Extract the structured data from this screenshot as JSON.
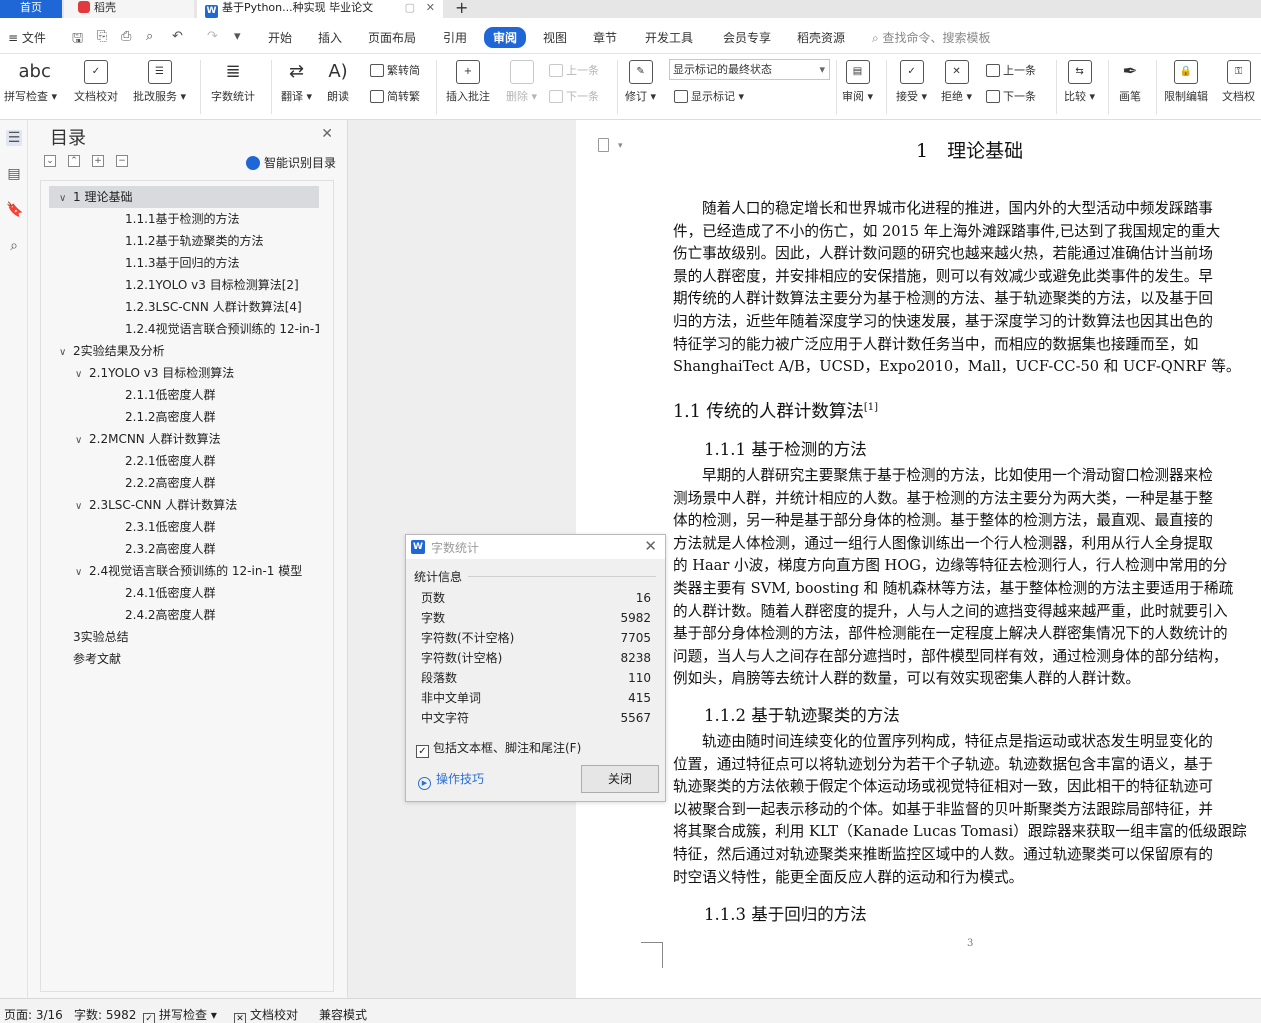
{
  "tabs": {
    "home": "首页",
    "daoke": "稻壳",
    "doc": "基于Python...种实现 毕业论文",
    "new_tab": "+"
  },
  "menu": {
    "file": "文件",
    "items": [
      "开始",
      "插入",
      "页面布局",
      "引用",
      "审阅",
      "视图",
      "章节",
      "开发工具",
      "会员专享",
      "稻壳资源"
    ],
    "active": "审阅",
    "search": "查找命令、搜索模板"
  },
  "ribbon": {
    "spell_check": "拼写检查",
    "doc_check": "文档校对",
    "batch_service": "批改服务",
    "word_count": "字数统计",
    "translate": "翻译",
    "read_aloud": "朗读",
    "to_traditional": "繁转简",
    "to_simplified": "简转繁",
    "insert_comment": "插入批注",
    "delete": "删除",
    "prev_comment": "上一条",
    "next_comment": "下一条",
    "revise": "修订",
    "markup_select": "显示标记的最终状态",
    "show_markup": "显示标记",
    "review": "审阅",
    "accept": "接受",
    "reject": "拒绝",
    "prev_change": "上一条",
    "next_change": "下一条",
    "compare": "比较",
    "pen": "画笔",
    "restrict_edit": "限制编辑",
    "doc_permission": "文档权"
  },
  "toc": {
    "title": "目录",
    "smart_label": "智能识别目录",
    "items": [
      {
        "text": "1 理论基础",
        "level": 1,
        "arrow": "∨"
      },
      {
        "text": "1.1.1基于检测的方法",
        "level": 3,
        "arrow": ""
      },
      {
        "text": "1.1.2基于轨迹聚类的方法",
        "level": 3,
        "arrow": ""
      },
      {
        "text": "1.1.3基于回归的方法",
        "level": 3,
        "arrow": ""
      },
      {
        "text": "1.2.1YOLO v3 目标检测算法[2]",
        "level": 3,
        "arrow": ""
      },
      {
        "text": "1.2.3LSC-CNN 人群计数算法[4]",
        "level": 3,
        "arrow": ""
      },
      {
        "text": "1.2.4视觉语言联合预训练的 12-in-1 ...",
        "level": 3,
        "arrow": ""
      },
      {
        "text": "2实验结果及分析",
        "level": 1,
        "arrow": "∨"
      },
      {
        "text": "2.1YOLO v3 目标检测算法",
        "level": 2,
        "arrow": "∨"
      },
      {
        "text": "2.1.1低密度人群",
        "level": 3,
        "arrow": ""
      },
      {
        "text": "2.1.2高密度人群",
        "level": 3,
        "arrow": ""
      },
      {
        "text": "2.2MCNN 人群计数算法",
        "level": 2,
        "arrow": "∨"
      },
      {
        "text": "2.2.1低密度人群",
        "level": 3,
        "arrow": ""
      },
      {
        "text": "2.2.2高密度人群",
        "level": 3,
        "arrow": ""
      },
      {
        "text": "2.3LSC-CNN 人群计数算法",
        "level": 2,
        "arrow": "∨"
      },
      {
        "text": "2.3.1低密度人群",
        "level": 3,
        "arrow": ""
      },
      {
        "text": "2.3.2高密度人群",
        "level": 3,
        "arrow": ""
      },
      {
        "text": "2.4视觉语言联合预训练的 12-in-1 模型",
        "level": 2,
        "arrow": "∨"
      },
      {
        "text": "2.4.1低密度人群",
        "level": 3,
        "arrow": ""
      },
      {
        "text": "2.4.2高密度人群",
        "level": 3,
        "arrow": ""
      },
      {
        "text": "3实验总结",
        "level": 1,
        "arrow": ""
      },
      {
        "text": "参考文献",
        "level": 1,
        "arrow": ""
      }
    ]
  },
  "document": {
    "h1": "1　理论基础",
    "para1": [
      "随着人口的稳定增长和世界城市化进程的推进，国内外的大型活动中频发踩踏事",
      "件，已经造成了不小的伤亡，如  2015 年上海外滩踩踏事件,已达到了我国规定的重大",
      "伤亡事故级别。因此，人群计数问题的研究也越来越火热，若能通过准确估计当前场",
      "景的人群密度，并安排相应的安保措施，则可以有效减少或避免此类事件的发生。早",
      "期传统的人群计数算法主要分为基于检测的方法、基于轨迹聚类的方法，以及基于回",
      "归的方法，近些年随着深度学习的快速发展，基于深度学习的计数算法也因其出色的",
      "特征学习的能力被广泛应用于人群计数任务当中，而相应的数据集也接踵而至，如",
      "ShanghaiTect A/B，UCSD，Expo2010，Mall，UCF-CC-50 和  UCF-QNRF 等。"
    ],
    "h2": "1.1 传统的人群计数算法",
    "h2_sup": "[1]",
    "h3_1": "1.1.1 基于检测的方法",
    "para2": [
      "早期的人群研究主要聚焦于基于检测的方法，比如使用一个滑动窗口检测器来检",
      "测场景中人群，并统计相应的人数。基于检测的方法主要分为两大类，一种是基于整",
      "体的检测，另一种是基于部分身体的检测。基于整体的检测方法，最直观、最直接的",
      "方法就是人体检测，通过一组行人图像训练出一个行人检测器，利用从行人全身提取",
      "的  Haar 小波，梯度方向直方图  HOG，边缘等特征去检测行人，行人检测中常用的分",
      "类器主要有  SVM, boosting 和  随机森林等方法，基于整体检测的方法主要适用于稀疏",
      "的人群计数。随着人群密度的提升，人与人之间的遮挡变得越来越严重，此时就要引入",
      "基于部分身体检测的方法，部件检测能在一定程度上解决人群密集情况下的人数统计的",
      "问题，当人与人之间存在部分遮挡时，部件模型同样有效，通过检测身体的部分结构，",
      "例如头，肩膀等去统计人群的数量，可以有效实现密集人群的人群计数。"
    ],
    "h3_2": "1.1.2 基于轨迹聚类的方法",
    "para3": [
      "轨迹由随时间连续变化的位置序列构成，特征点是指运动或状态发生明显变化的",
      "位置，通过特征点可以将轨迹划分为若干个子轨迹。轨迹数据包含丰富的语义，基于",
      "轨迹聚类的方法依赖于假定个体运动场或视觉特征相对一致，因此相干的特征轨迹可",
      "以被聚合到一起表示移动的个体。如基于非监督的贝叶斯聚类方法跟踪局部特征，并",
      "将其聚合成簇，利用  KLT（Kanade Lucas Tomasi）跟踪器来获取一组丰富的低级跟踪",
      "特征，然后通过对轨迹聚类来推断监控区域中的人数。通过轨迹聚类可以保留原有的",
      "时空语义特性，能更全面反应人群的运动和行为模式。"
    ],
    "h3_3": "1.1.3 基于回归的方法",
    "page_number": "3"
  },
  "dialog": {
    "title": "字数统计",
    "section": "统计信息",
    "rows": [
      {
        "label": "页数",
        "value": "16"
      },
      {
        "label": "字数",
        "value": "5982"
      },
      {
        "label": "字符数(不计空格)",
        "value": "7705"
      },
      {
        "label": "字符数(计空格)",
        "value": "8238"
      },
      {
        "label": "段落数",
        "value": "110"
      },
      {
        "label": "非中文单词",
        "value": "415"
      },
      {
        "label": "中文字符",
        "value": "5567"
      }
    ],
    "checkbox_label": "包括文本框、脚注和尾注(F)",
    "tips": "操作技巧",
    "close_button": "关闭"
  },
  "status": {
    "page": "页面: 3/16",
    "words": "字数: 5982",
    "spell": "拼写检查",
    "proof": "文档校对",
    "compat": "兼容模式"
  }
}
